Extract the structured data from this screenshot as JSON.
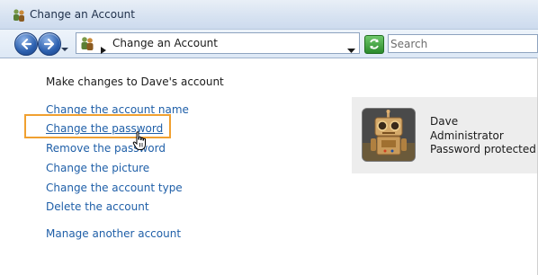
{
  "window": {
    "title": "Change an Account",
    "title_icon": "user-accounts-icon"
  },
  "toolbar": {
    "back_icon": "back-arrow-icon",
    "forward_icon": "forward-arrow-icon",
    "address_icon": "user-accounts-icon",
    "breadcrumb": "Change an Account",
    "refresh_icon": "refresh-icon",
    "search_placeholder": "Search"
  },
  "main": {
    "heading": "Make changes to Dave's account",
    "tasks": [
      {
        "label": "Change the account name"
      },
      {
        "label": "Change the password"
      },
      {
        "label": "Remove the password"
      },
      {
        "label": "Change the picture"
      },
      {
        "label": "Change the account type"
      },
      {
        "label": "Delete the account"
      }
    ],
    "manage_link": "Manage another account"
  },
  "account": {
    "name": "Dave",
    "type": "Administrator",
    "status": "Password protected",
    "picture": "robot-avatar"
  },
  "colors": {
    "link": "#1f5fa8",
    "highlight": "#f0a030",
    "card_bg": "#ededed"
  }
}
